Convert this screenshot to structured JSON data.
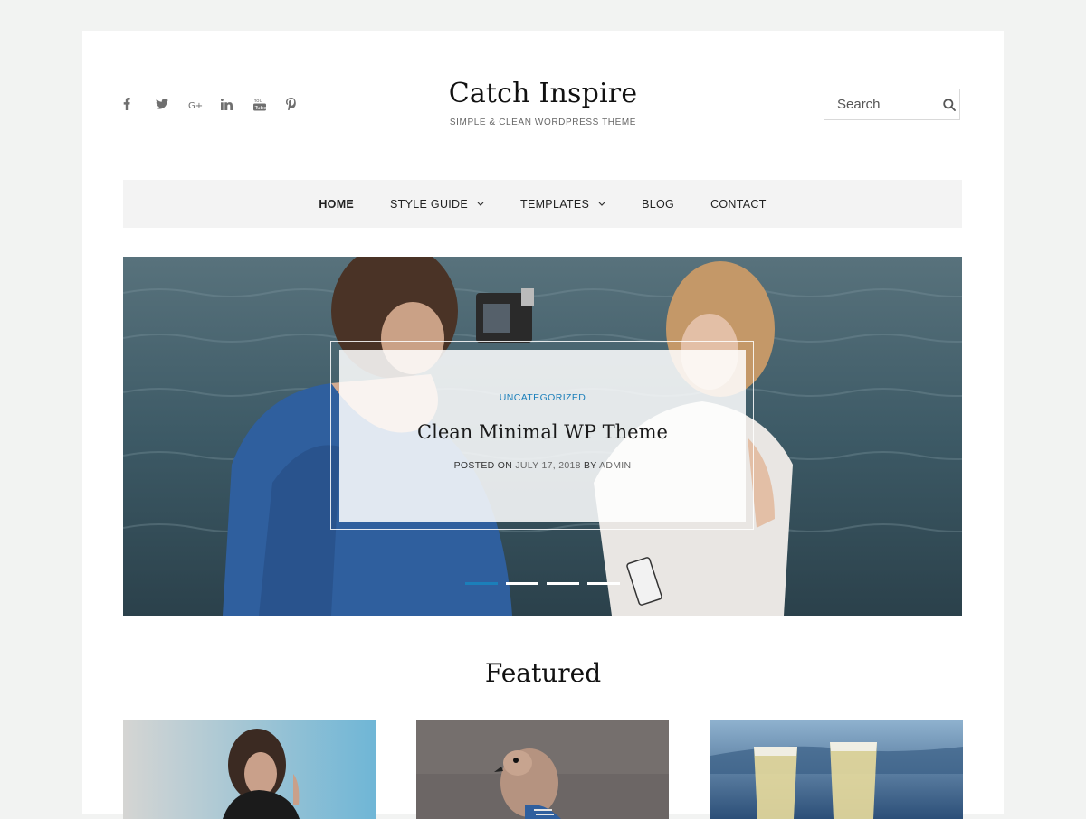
{
  "header": {
    "site_title": "Catch Inspire",
    "tagline": "SIMPLE & CLEAN WORDPRESS THEME",
    "social_icons": [
      "facebook-icon",
      "twitter-icon",
      "google-plus-icon",
      "linkedin-icon",
      "youtube-icon",
      "pinterest-icon"
    ],
    "search": {
      "placeholder": "Search",
      "value": ""
    }
  },
  "nav": {
    "items": [
      {
        "label": "HOME",
        "active": true,
        "has_dropdown": false
      },
      {
        "label": "STYLE GUIDE",
        "active": false,
        "has_dropdown": true
      },
      {
        "label": "TEMPLATES",
        "active": false,
        "has_dropdown": true
      },
      {
        "label": "BLOG",
        "active": false,
        "has_dropdown": false
      },
      {
        "label": "CONTACT",
        "active": false,
        "has_dropdown": false
      }
    ]
  },
  "hero": {
    "category": "UNCATEGORIZED",
    "title": "Clean Minimal WP Theme",
    "meta": {
      "posted_on_label": "POSTED ON",
      "date": "JULY 17, 2018",
      "by_label": "BY",
      "author": "ADMIN"
    },
    "slides_count": 4,
    "active_slide": 1
  },
  "featured": {
    "heading": "Featured"
  },
  "colors": {
    "accent": "#1b7fba",
    "page_bg": "#f2f3f2",
    "nav_bg": "#f3f3f3"
  }
}
